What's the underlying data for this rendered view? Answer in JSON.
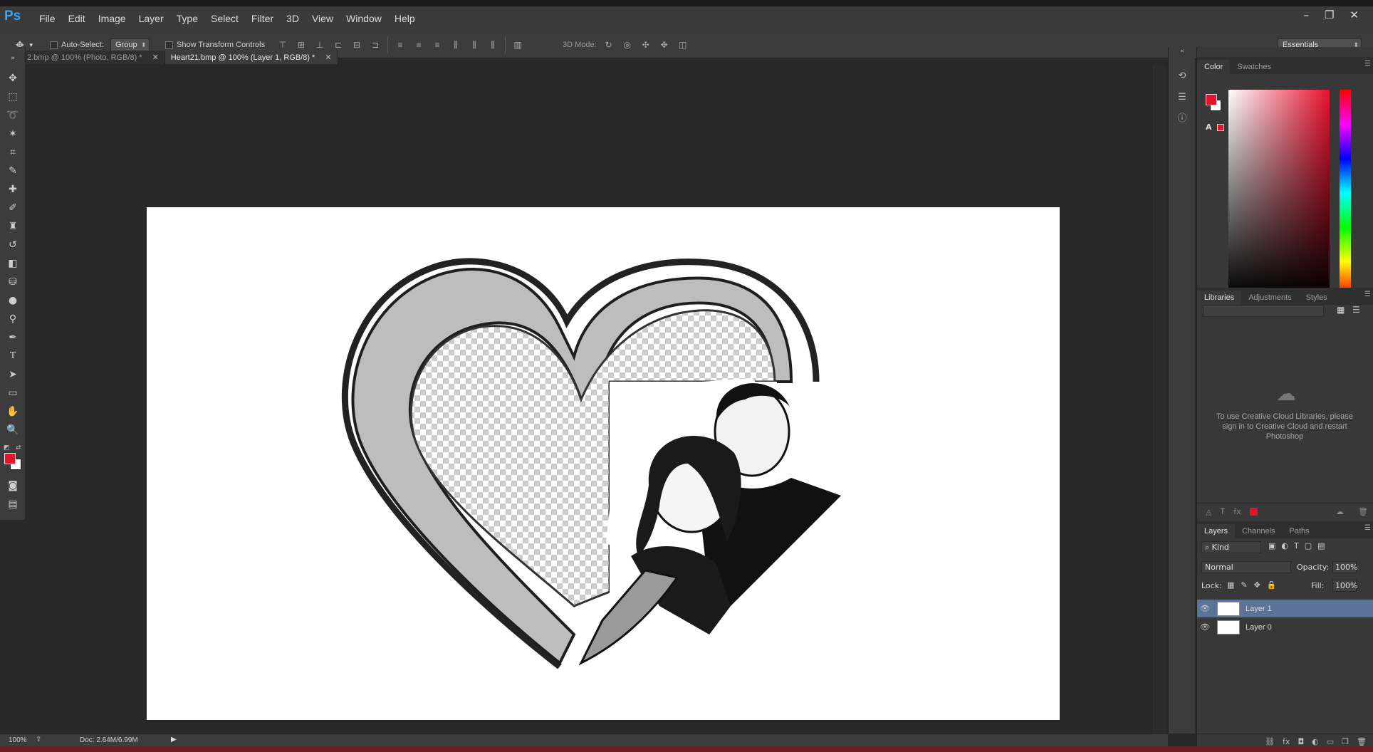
{
  "app": {
    "logo": "Ps"
  },
  "menu": [
    "File",
    "Edit",
    "Image",
    "Layer",
    "Type",
    "Select",
    "Filter",
    "3D",
    "View",
    "Window",
    "Help"
  ],
  "options": {
    "auto_select_label": "Auto-Select:",
    "auto_select_value": "Group",
    "show_transform_label": "Show Transform Controls",
    "mode3d_label": "3D Mode:",
    "workspace": "Essentials"
  },
  "tabs": [
    {
      "label": "2.bmp @ 100% (Photo, RGB/8) *",
      "active": false
    },
    {
      "label": "Heart21.bmp @ 100% (Layer 1, RGB/8) *",
      "active": true
    }
  ],
  "color_panel": {
    "tabs": [
      "Color",
      "Swatches"
    ],
    "fg": "#e8112d",
    "bg": "#ffffff",
    "hue": "#e8112d"
  },
  "libraries_panel": {
    "tabs": [
      "Libraries",
      "Adjustments",
      "Styles"
    ],
    "message": "To use Creative Cloud Libraries, please sign in to Creative Cloud and restart Photoshop"
  },
  "layers_panel": {
    "tabs": [
      "Layers",
      "Channels",
      "Paths"
    ],
    "filter": "Kind",
    "blend": "Normal",
    "opacity_label": "Opacity:",
    "opacity": "100%",
    "lock_label": "Lock:",
    "fill_label": "Fill:",
    "fill": "100%",
    "layers": [
      {
        "name": "Layer 1",
        "selected": true
      },
      {
        "name": "Layer 0",
        "selected": false
      }
    ]
  },
  "status": {
    "zoom": "100%",
    "doc": "Doc: 2.64M/6.99M"
  }
}
